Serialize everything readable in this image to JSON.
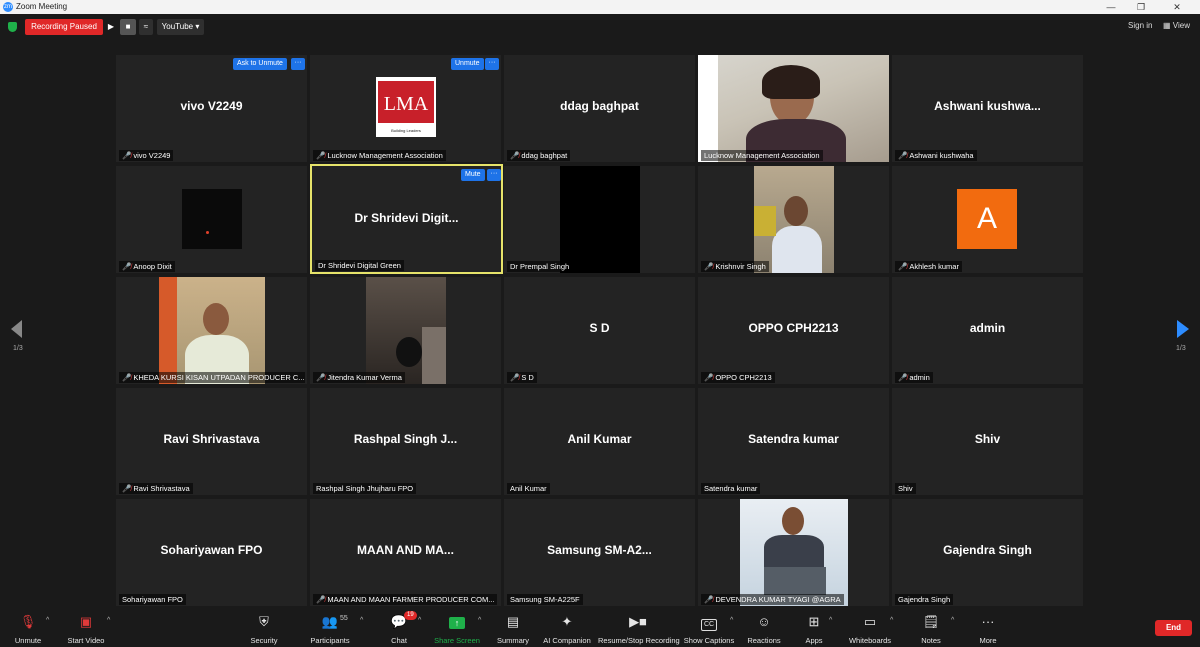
{
  "window": {
    "title": "Zoom Meeting",
    "logo_text": "zm"
  },
  "topbar": {
    "recording_status": "Recording Paused",
    "stream_target": "YouTube",
    "sign_in": "Sign in",
    "view": "View"
  },
  "tiles": [
    {
      "name": "vivo V2249",
      "label": "vivo V2249",
      "muted": true,
      "overlay": "Ask to Unmute"
    },
    {
      "name": "",
      "label": "Lucknow Management Association",
      "muted": true,
      "overlay": "Unmute",
      "logo": "LMA",
      "logo_tag": "Building Leaders"
    },
    {
      "name": "ddag baghpat",
      "label": "ddag baghpat",
      "muted": true
    },
    {
      "name": "",
      "label": "Lucknow Management Association",
      "muted": false,
      "video": true
    },
    {
      "name": "Ashwani  kushwa...",
      "label": "Ashwani kushwaha",
      "muted": true
    },
    {
      "name": "",
      "label": "Anoop Dixit",
      "muted": true,
      "video": true
    },
    {
      "name": "Dr Shridevi Digit...",
      "label": "Dr Shridevi Digital Green",
      "muted": false,
      "overlay": "Mute",
      "active": true
    },
    {
      "name": "",
      "label": "Dr Prempal Singh",
      "muted": false,
      "video": true
    },
    {
      "name": "",
      "label": "Krishnvir Singh",
      "muted": true,
      "video": true
    },
    {
      "name": "",
      "label": "Akhlesh kumar",
      "muted": true,
      "avatar": "A"
    },
    {
      "name": "",
      "label": "KHEDA KURSI KISAN UTPADAN PRODUCER C...",
      "muted": true,
      "video": true
    },
    {
      "name": "",
      "label": "Jitendra Kumar Verma",
      "muted": true,
      "video": true
    },
    {
      "name": "S D",
      "label": "S D",
      "muted": true
    },
    {
      "name": "OPPO CPH2213",
      "label": "OPPO CPH2213",
      "muted": true
    },
    {
      "name": "admin",
      "label": "admin",
      "muted": true
    },
    {
      "name": "Ravi Shrivastava",
      "label": "Ravi Shrivastava",
      "muted": true
    },
    {
      "name": "Rashpal Singh  J...",
      "label": "Rashpal Singh Jhujharu FPO",
      "muted": false
    },
    {
      "name": "Anil Kumar",
      "label": "Anil Kumar",
      "muted": false
    },
    {
      "name": "Satendra kumar",
      "label": "Satendra kumar",
      "muted": false
    },
    {
      "name": "Shiv",
      "label": "Shiv",
      "muted": false
    },
    {
      "name": "Sohariyawan FPO",
      "label": "Sohariyawan FPO",
      "muted": false
    },
    {
      "name": "MAAN  AND  MA...",
      "label": "MAAN AND MAAN FARMER PRODUCER COM...",
      "muted": true
    },
    {
      "name": "Samsung  SM-A2...",
      "label": "Samsung SM-A225F",
      "muted": false
    },
    {
      "name": "",
      "label": "DEVENDRA KUMAR TYAGI @AGRA",
      "muted": true,
      "video": true
    },
    {
      "name": "Gajendra Singh",
      "label": "Gajendra Singh",
      "muted": false
    }
  ],
  "pagination": {
    "left": "1/3",
    "right": "1/3"
  },
  "toolbar": {
    "unmute": "Unmute",
    "start_video": "Start Video",
    "security": "Security",
    "participants": "Participants",
    "participants_count": "55",
    "chat": "Chat",
    "chat_badge": "19",
    "share_screen": "Share Screen",
    "summary": "Summary",
    "ai_companion": "AI Companion",
    "recording": "Resume/Stop Recording",
    "captions": "Show Captions",
    "reactions": "Reactions",
    "apps": "Apps",
    "whiteboards": "Whiteboards",
    "notes": "Notes",
    "more": "More",
    "end": "End"
  },
  "colors": {
    "share": "#1fb04a",
    "record": "#e02828",
    "accent": "#1e73e8",
    "active_border": "#e6e36a"
  }
}
